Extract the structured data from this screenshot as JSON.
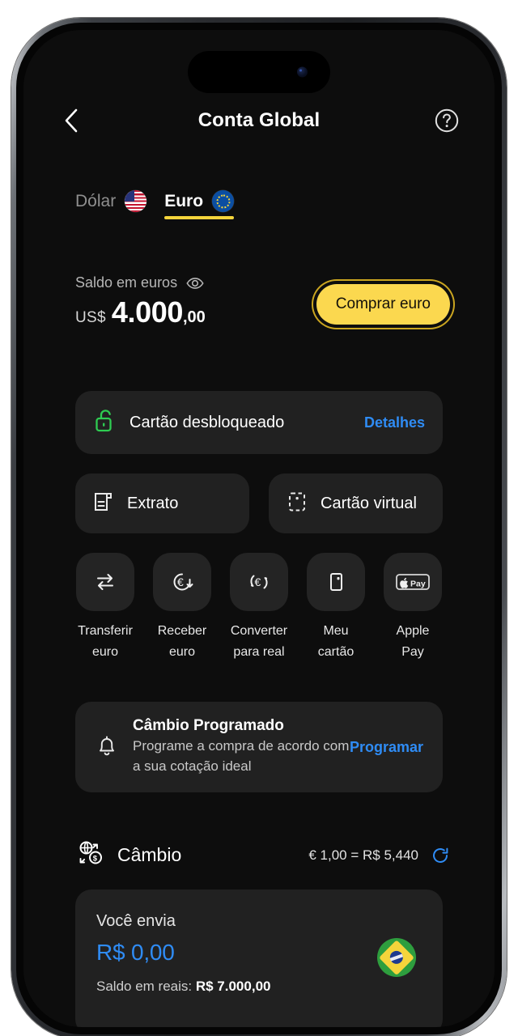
{
  "header": {
    "title": "Conta Global",
    "back_icon": "chevron-left-icon",
    "help_icon": "question-circle-icon"
  },
  "currency_tabs": [
    {
      "label": "Dólar",
      "flag": "us-flag-icon",
      "active": false
    },
    {
      "label": "Euro",
      "flag": "eu-flag-icon",
      "active": true
    }
  ],
  "balance": {
    "label": "Saldo em euros",
    "eye_icon": "eye-icon",
    "currency": "US$",
    "integer": "4.000",
    "decimals": ",00",
    "buy_button": "Comprar euro"
  },
  "card_status": {
    "lock_icon": "unlocked-padlock-icon",
    "text": "Cartão desbloqueado",
    "action": "Detalhes"
  },
  "quick_buttons": [
    {
      "label": "Extrato",
      "icon": "statement-document-icon"
    },
    {
      "label": "Cartão virtual",
      "icon": "virtual-card-dashed-icon"
    }
  ],
  "actions": [
    {
      "label": "Transferir\neuro",
      "icon": "transfer-arrows-icon"
    },
    {
      "label": "Receber\neuro",
      "icon": "euro-receive-icon"
    },
    {
      "label": "Converter\npara real",
      "icon": "euro-convert-icon"
    },
    {
      "label": "Meu\ncartão",
      "icon": "card-icon"
    },
    {
      "label": "Apple\nPay",
      "icon": "apple-pay-icon"
    }
  ],
  "scheduled_exchange": {
    "icon": "bell-icon",
    "title": "Câmbio Programado",
    "subtitle": "Programe a compra de acordo com a sua cotação ideal",
    "action": "Programar"
  },
  "exchange": {
    "icon": "globe-exchange-icon",
    "title": "Câmbio",
    "rate": "€ 1,00 = R$ 5,440",
    "refresh_icon": "refresh-icon"
  },
  "send": {
    "label": "Você envia",
    "amount": "R$ 0,00",
    "balance_prefix": "Saldo em reais: ",
    "balance_value": "R$ 7.000,00",
    "flag": "br-flag-icon"
  },
  "colors": {
    "background": "#0d0d0d",
    "card": "#212121",
    "accent_yellow": "#FBD84F",
    "link_blue": "#2F8CF5",
    "lock_green": "#2ECC52"
  }
}
